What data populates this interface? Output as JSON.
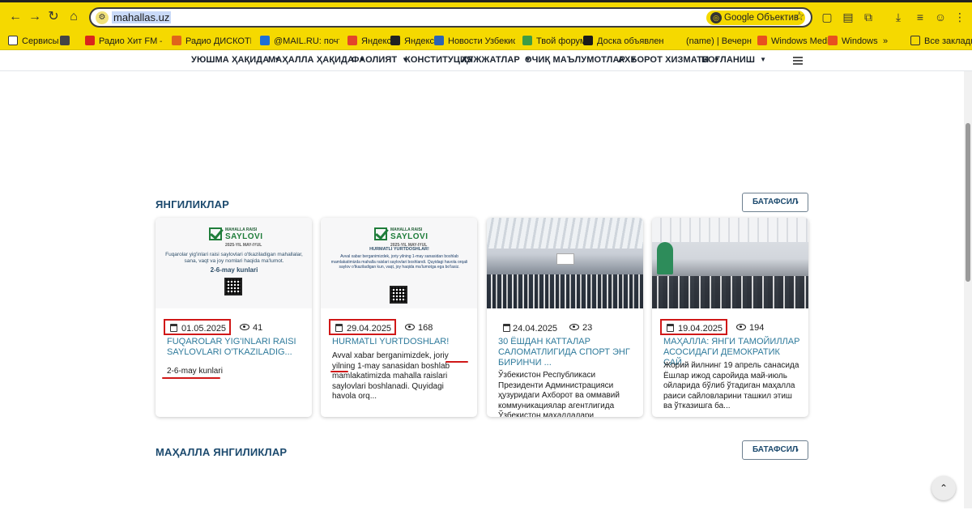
{
  "browser": {
    "url": "mahallas.uz",
    "lens_label": "Google Объектив",
    "bookmarks": [
      {
        "label": "Сервисы",
        "color": "#ffffff"
      },
      {
        "label": "Радио Хит FM — сл...",
        "color": "#d9261c"
      },
      {
        "label": "Радио ДИСКОТЕКА...",
        "color": "#e0651b"
      },
      {
        "label": "@MAIL.RU: почта,...",
        "color": "#1d6fd6"
      },
      {
        "label": "Яндекс",
        "color": "#e3452a"
      },
      {
        "label": "Яндекс",
        "color": "#222222"
      },
      {
        "label": "Новости Узбекиста...",
        "color": "#2b63b5"
      },
      {
        "label": "Твой форум!",
        "color": "#3d9c45"
      },
      {
        "label": "Доска объявлений...",
        "color": "#1a1a1a"
      },
      {
        "label": "(name) | Вечерний...",
        "color": "#f5d900"
      },
      {
        "label": "Windows Media",
        "color": "#e8501f"
      },
      {
        "label": "Windows",
        "color": "#e8501f"
      }
    ],
    "all_bookmarks": "Все закладки"
  },
  "nav": {
    "items": [
      "УЮШМА ҲАҚИДА",
      "МАҲАЛЛА ҲАҚИДА",
      "ФАОЛИЯТ",
      "КОНСТИТУЦИЯ",
      "ҲУЖЖАТЛАР",
      "ОЧИҚ МАЪЛУМОТЛАР",
      "АХБОРОТ ХИЗМАТИ",
      "БОҒЛАНИШ"
    ]
  },
  "news": {
    "title": "ЯНГИЛИКЛАР",
    "more": "БАТАФСИЛ",
    "cards": [
      {
        "poster_small": "MAHALLA RAISI",
        "poster_big": "SAYLOVI",
        "poster_sub": "2025-YIL MAY-IYUL",
        "poster_text": "Fuqarolar yig'inlari raisi saylovlari o'tkaziladigan mahallalar, sana, vaqt va joy nomlari haqida ma'lumot.",
        "poster_dates": "2-6-may kunlari",
        "date": "01.05.2025",
        "views": "41",
        "title": "FUQAROLAR YIG'INLARI RAISI SAYLOVLARI O'TKAZILADIG...",
        "excerpt": "2-6-may kunlari"
      },
      {
        "poster_small": "MAHALLA RAISI",
        "poster_big": "SAYLOVI",
        "poster_sub": "2025-YIL MAY-IYUL",
        "poster_heading": "HURMATLI YURTDOSHLAR!",
        "poster_text": "Avval xabar berganimizdek, joriy yilning 1-may sanasidan boshlab mamlakatimizda mahalla raislari saylovlari boshlandi. Quyidagi havola orqali saylov o'tkaziladigan kun, vaqt, joy haqida ma'lumotga ega bo'lasiz.",
        "date": "29.04.2025",
        "views": "168",
        "title": "HURMATLI YURTDOSHLAR!",
        "excerpt": "Avval xabar berganimizdek, joriy yilning 1-may sanasidan boshlab mamlakatimizda mahalla raislari saylovlari boshlanadi. Quyidagi havola orq..."
      },
      {
        "date": "24.04.2025",
        "views": "23",
        "title": "30 ЁШДАН КАТТАЛАР САЛОМАТЛИГИДА СПОРТ ЭНГ БИРИНЧИ ...",
        "excerpt": "Ўзбекистон Республикаси Президенти Администрацияси ҳузуридаги Ахборот ва оммавий коммуникациялар агентлигида Ўзбекистон маҳаллалари уюшмаси,..."
      },
      {
        "date": "19.04.2025",
        "views": "194",
        "title": "МАҲАЛЛА: ЯНГИ ТАМОЙИЛЛАР АСОСИДАГИ ДЕМОКРАТИК САЙ...",
        "excerpt": "Жорий йилнинг 19 апрель санасида Ёшлар ижод саройида май-июль ойларида бўлиб ўтадиган маҳалла раиси сайловларини ташкил этиш ва ўтказишга ба..."
      }
    ]
  },
  "mahalla_news": {
    "title": "МАҲАЛЛА ЯНГИЛИКЛАР",
    "more": "БАТАФСИЛ"
  },
  "colors": {
    "chrome_yellow": "#f5d900",
    "heading_blue": "#1c4a6e",
    "link_teal": "#2e7a9b",
    "highlight_red": "#d01818"
  }
}
